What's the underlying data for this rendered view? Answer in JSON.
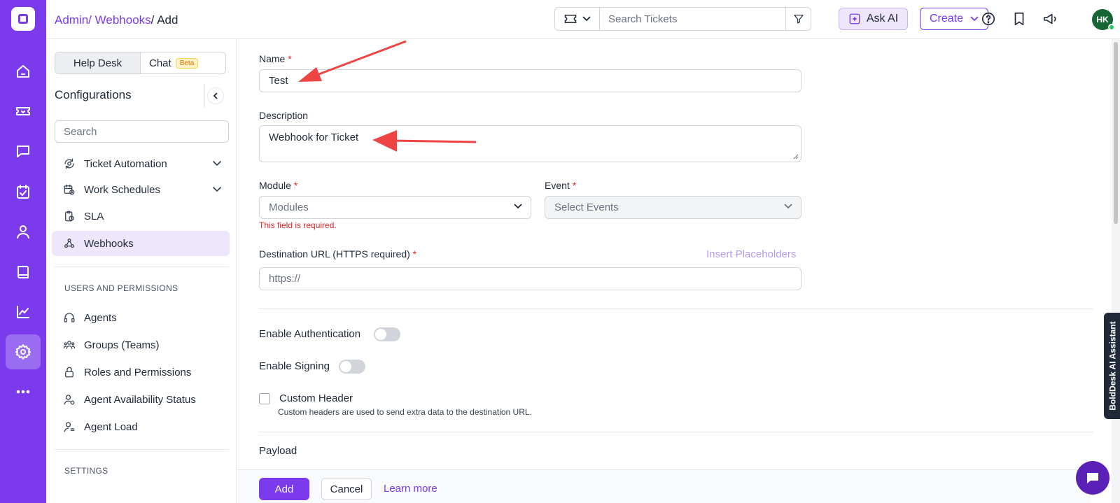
{
  "breadcrumb": {
    "part1": "Admin/",
    "part2": "Webhooks",
    "sep": "/",
    "current": "Add"
  },
  "topbar": {
    "search_placeholder": "Search Tickets",
    "ask_ai": "Ask AI",
    "create": "Create",
    "avatar_initials": "HK"
  },
  "sidebar": {
    "tab_helpdesk": "Help Desk",
    "tab_chat": "Chat",
    "beta": "Beta",
    "heading": "Configurations",
    "search_placeholder": "Search",
    "items": [
      {
        "label": "Ticket Automation"
      },
      {
        "label": "Work Schedules"
      },
      {
        "label": "SLA"
      },
      {
        "label": "Webhooks"
      }
    ],
    "users_group": "USERS AND PERMISSIONS",
    "users_items": [
      {
        "label": "Agents"
      },
      {
        "label": "Groups (Teams)"
      },
      {
        "label": "Roles and Permissions"
      },
      {
        "label": "Agent Availability Status"
      },
      {
        "label": "Agent Load"
      }
    ],
    "settings_group": "SETTINGS"
  },
  "form": {
    "name_label": "Name",
    "name_value": "Test",
    "description_label": "Description",
    "description_value": "Webhook for Ticket",
    "module_label": "Module",
    "module_placeholder": "Modules",
    "module_error": "This field is required.",
    "event_label": "Event",
    "event_placeholder": "Select Events",
    "url_label": "Destination URL (HTTPS required)",
    "insert_placeholders": "Insert Placeholders",
    "url_placeholder": "https://",
    "enable_auth": "Enable Authentication",
    "enable_signing": "Enable Signing",
    "custom_header": "Custom Header",
    "custom_header_help": "Custom headers are used to send extra data to the destination URL.",
    "payload": "Payload",
    "required_mark": "*"
  },
  "footer": {
    "add": "Add",
    "cancel": "Cancel",
    "learn_more": "Learn more"
  },
  "ai_assistant": "BoldDesk AI Assistant",
  "colors": {
    "brand": "#7c3aed",
    "annotation_arrow": "#ef4444",
    "error": "#dc2626"
  }
}
